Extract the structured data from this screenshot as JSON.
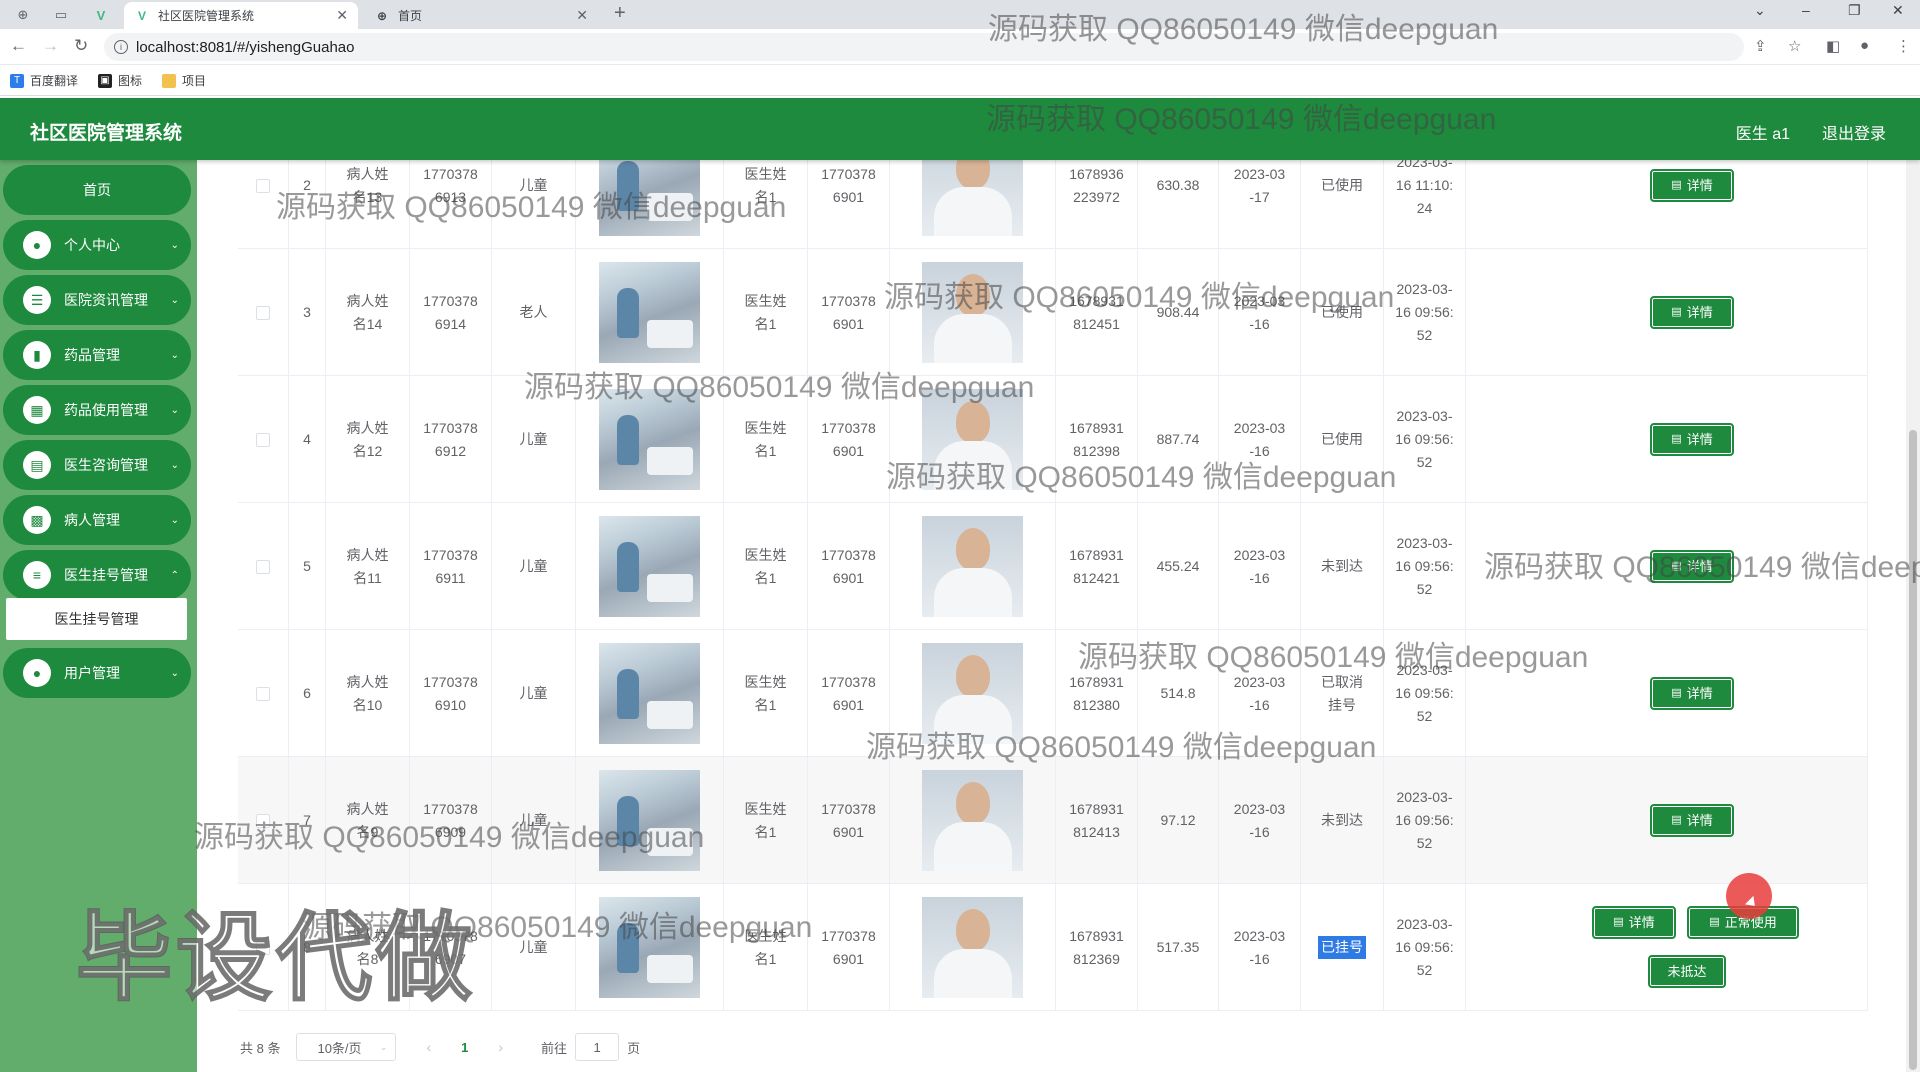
{
  "browser": {
    "tabs": [
      {
        "title": "社区医院管理系统",
        "active": true
      },
      {
        "title": "首页",
        "active": false
      }
    ],
    "url": "localhost:8081/#/yishengGuahao",
    "bookmarks": [
      "百度翻译",
      "图标",
      "项目"
    ]
  },
  "header": {
    "title": "社区医院管理系统",
    "user": "医生 a1",
    "logout": "退出登录",
    "color": "#1e8a3e"
  },
  "sidebar": {
    "home": "首页",
    "items": [
      {
        "label": "个人中心",
        "icon": "user-icon"
      },
      {
        "label": "医院资讯管理",
        "icon": "list-icon"
      },
      {
        "label": "药品管理",
        "icon": "chart-icon"
      },
      {
        "label": "药品使用管理",
        "icon": "grid-icon"
      },
      {
        "label": "医生咨询管理",
        "icon": "clipboard-icon"
      },
      {
        "label": "病人管理",
        "icon": "apps-icon"
      },
      {
        "label": "医生挂号管理",
        "icon": "menu-icon"
      }
    ],
    "active_sub": "医生挂号管理",
    "last_item": {
      "label": "用户管理",
      "icon": "user-icon"
    }
  },
  "table": {
    "rows": [
      {
        "index": "2",
        "patient_name": "病人姓名13",
        "patient_phone": "17703786913",
        "patient_type": "儿童",
        "doctor_name": "医生姓名1",
        "doctor_phone": "17703786901",
        "reg_no": "1678936223972",
        "fee": "630.38",
        "reg_date": "2023-03-17",
        "status": "已使用",
        "time": "2023-03-16 11:10:24"
      },
      {
        "index": "3",
        "patient_name": "病人姓名14",
        "patient_phone": "17703786914",
        "patient_type": "老人",
        "doctor_name": "医生姓名1",
        "doctor_phone": "17703786901",
        "reg_no": "1678931812451",
        "fee": "908.44",
        "reg_date": "2023-03-16",
        "status": "已使用",
        "time": "2023-03-16 09:56:52"
      },
      {
        "index": "4",
        "patient_name": "病人姓名12",
        "patient_phone": "17703786912",
        "patient_type": "儿童",
        "doctor_name": "医生姓名1",
        "doctor_phone": "17703786901",
        "reg_no": "1678931812398",
        "fee": "887.74",
        "reg_date": "2023-03-16",
        "status": "已使用",
        "time": "2023-03-16 09:56:52"
      },
      {
        "index": "5",
        "patient_name": "病人姓名11",
        "patient_phone": "17703786911",
        "patient_type": "儿童",
        "doctor_name": "医生姓名1",
        "doctor_phone": "17703786901",
        "reg_no": "1678931812421",
        "fee": "455.24",
        "reg_date": "2023-03-16",
        "status": "未到达",
        "time": "2023-03-16 09:56:52"
      },
      {
        "index": "6",
        "patient_name": "病人姓名10",
        "patient_phone": "17703786910",
        "patient_type": "儿童",
        "doctor_name": "医生姓名1",
        "doctor_phone": "17703786901",
        "reg_no": "1678931812380",
        "fee": "514.8",
        "reg_date": "2023-03-16",
        "status": "已取消挂号",
        "time": "2023-03-16 09:56:52"
      },
      {
        "index": "7",
        "patient_name": "病人姓名9",
        "patient_phone": "17703786909",
        "patient_type": "儿童",
        "doctor_name": "医生姓名1",
        "doctor_phone": "17703786901",
        "reg_no": "1678931812413",
        "fee": "97.12",
        "reg_date": "2023-03-16",
        "status": "未到达",
        "time": "2023-03-16 09:56:52"
      },
      {
        "index": "8",
        "patient_name": "病人姓名8",
        "patient_phone": "17703786907",
        "patient_type": "儿童",
        "doctor_name": "医生姓名1",
        "doctor_phone": "17703786901",
        "reg_no": "1678931812369",
        "fee": "517.35",
        "reg_date": "2023-03-16",
        "status": "已挂号",
        "time": "2023-03-16 09:56:52"
      }
    ],
    "detail_label": "详情",
    "use_label": "正常使用",
    "noshow_label": "未抵达"
  },
  "pagination": {
    "total": "共 8 条",
    "page_size": "10条/页",
    "current": "1",
    "goto": "前往",
    "goto_value": "1",
    "unit": "页"
  },
  "watermarks": {
    "text": "源码获取 QQ86050149 微信deepguan",
    "big": "毕设代做"
  }
}
